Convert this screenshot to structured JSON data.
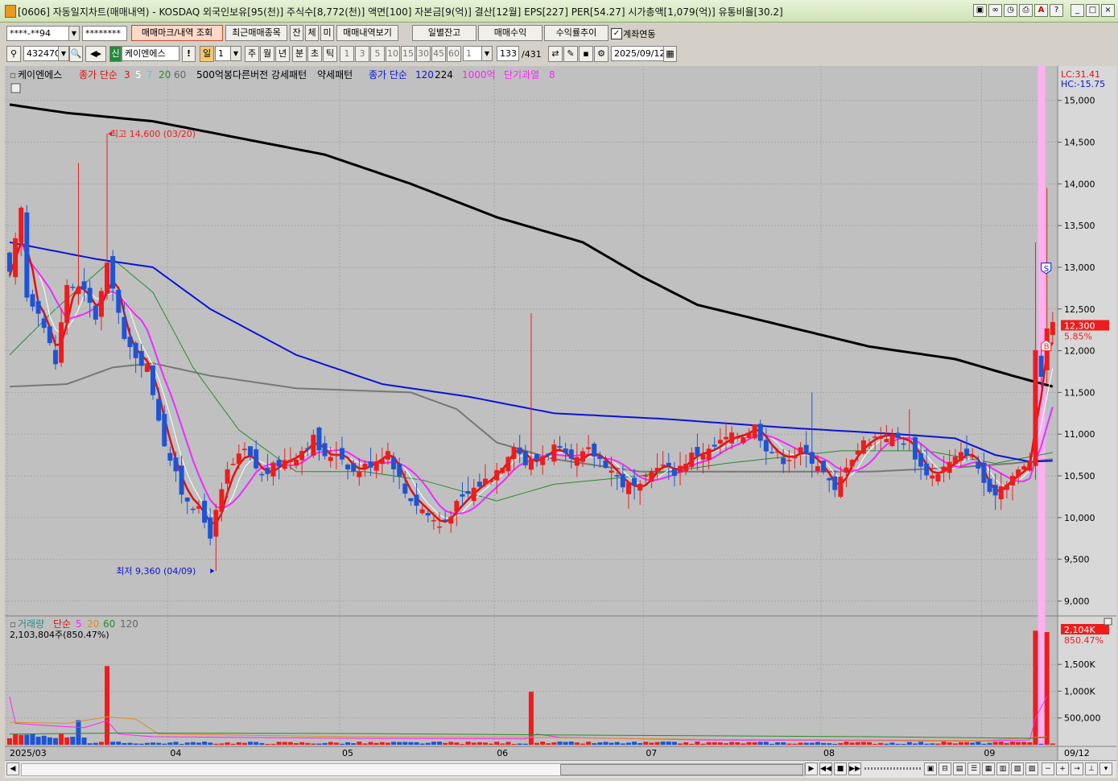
{
  "window": {
    "title": "[0606] 자동일지차트(매매내역) - KOSDAQ 외국인보유[95(천)] 주식수[8,772(천)] 액면[100] 자본금[9(억)] 결산[12월] EPS[227] PER[54.27] 시가총액[1,079(억)] 유통비율[30.2]"
  },
  "toolbar1": {
    "account": "****-**94",
    "password": "********",
    "btn_mark": "매매마크/내역 조회",
    "btn_recent": "최근매매종목",
    "btn_jan": "잔",
    "btn_che": "체",
    "btn_mi": "미",
    "btn_history": "매매내역보기",
    "btn_daily": "일별잔고",
    "btn_profit": "매매수익",
    "btn_trend": "수익률추이",
    "link_label": "계좌연동",
    "link_checked": true
  },
  "toolbar2": {
    "code": "432470",
    "stock_badge": "신",
    "stock_name": "케이엔에스",
    "period_day": "일",
    "period_num": "1",
    "periods": [
      "주",
      "월",
      "년",
      "분",
      "초",
      "틱"
    ],
    "intervals": [
      "1",
      "3",
      "5",
      "10",
      "15",
      "30",
      "45",
      "60"
    ],
    "interval_sel": "1",
    "count": "133",
    "total": "/431",
    "date": "2025/09/12"
  },
  "colors": {
    "up": "#ee1c1c",
    "down": "#1e54d4",
    "ma3": "#e01010",
    "ma5": "#ffffff",
    "ma7": "#7fe0e0",
    "ma20": "#2a8a2a",
    "ma60": "#777777",
    "ma120": "#0a14d8",
    "ma224": "#000000",
    "ma_mag": "#ff22ff",
    "bg": "#c0c0c0"
  },
  "legend": {
    "stock": "케이엔에스",
    "price_ma": "종가 단순",
    "p3": "3",
    "p5": "5",
    "p7": "7",
    "p20": "20",
    "p60": "60",
    "pattern1": "500억봉다른버전 강세패턴",
    "pattern2": "약세패턴",
    "ma120_label": "종가 단순",
    "p120": "120",
    "p224": "224",
    "thousand": "1000억",
    "short_over": "단기과열",
    "short_n": "8"
  },
  "right_info": {
    "lc": "LC:31.41",
    "hc": "HC:-15.75",
    "last_price": "12,300",
    "last_pct": "5.85%",
    "vol_last": "2,104K",
    "vol_pct": "850.47%"
  },
  "annotations": {
    "high": "최고 14,600 (03/20)",
    "low": "최저 9,360 (04/09)",
    "sell_mark": "S",
    "buy_mark": "B"
  },
  "volume_legend": {
    "title": "거래량",
    "ma": "단순",
    "p5": "5",
    "p20": "20",
    "p60": "60",
    "p120": "120",
    "info": "2,103,804주(850.47%)"
  },
  "chart_data": {
    "type": "candlestick",
    "price_axis": {
      "ticks": [
        9000,
        9500,
        10000,
        10500,
        11000,
        11500,
        12000,
        12500,
        13000,
        13500,
        14000,
        14500,
        15000
      ],
      "tick_labels": [
        "9,000",
        "9,500",
        "10,000",
        "10,500",
        "11,000",
        "11,500",
        "12,000",
        "12,500",
        "13,000",
        "13,500",
        "14,000",
        "14,500",
        "15,000"
      ],
      "ylim": [
        8850,
        15200
      ]
    },
    "volume_axis": {
      "ticks": [
        500000,
        1000000,
        1500000
      ],
      "tick_labels": [
        "500,000",
        "1,000K",
        "1,500K"
      ],
      "ylim": [
        0,
        2300000
      ]
    },
    "x_labels": [
      {
        "label": "2025/03",
        "index": 0
      },
      {
        "label": "04",
        "index": 28
      },
      {
        "label": "05",
        "index": 58
      },
      {
        "label": "06",
        "index": 85
      },
      {
        "label": "07",
        "index": 111
      },
      {
        "label": "08",
        "index": 142
      },
      {
        "label": "09",
        "index": 170
      },
      {
        "label": "09/12",
        "index": 181
      }
    ],
    "highlight_index": 180,
    "anchors": [
      [
        0,
        12900
      ],
      [
        2,
        13700
      ],
      [
        3,
        12650
      ],
      [
        5,
        12500
      ],
      [
        8,
        11850
      ],
      [
        10,
        12800
      ],
      [
        13,
        12700
      ],
      [
        15,
        12400
      ],
      [
        17,
        13000
      ],
      [
        18,
        12800
      ],
      [
        20,
        12100
      ],
      [
        22,
        11950
      ],
      [
        24,
        11800
      ],
      [
        27,
        10900
      ],
      [
        30,
        10300
      ],
      [
        33,
        10080
      ],
      [
        35,
        9800
      ],
      [
        38,
        10550
      ],
      [
        41,
        10800
      ],
      [
        44,
        10500
      ],
      [
        47,
        10650
      ],
      [
        50,
        10750
      ],
      [
        53,
        10950
      ],
      [
        55,
        10700
      ],
      [
        57,
        10800
      ],
      [
        60,
        10550
      ],
      [
        63,
        10650
      ],
      [
        66,
        10800
      ],
      [
        69,
        10300
      ],
      [
        72,
        10100
      ],
      [
        75,
        9900
      ],
      [
        78,
        10150
      ],
      [
        81,
        10350
      ],
      [
        84,
        10500
      ],
      [
        86,
        10650
      ],
      [
        88,
        10900
      ],
      [
        90,
        10650
      ],
      [
        92,
        10700
      ],
      [
        95,
        10850
      ],
      [
        98,
        10650
      ],
      [
        101,
        10800
      ],
      [
        104,
        10650
      ],
      [
        107,
        10400
      ],
      [
        110,
        10350
      ],
      [
        113,
        10650
      ],
      [
        116,
        10550
      ],
      [
        119,
        10750
      ],
      [
        122,
        10800
      ],
      [
        125,
        10950
      ],
      [
        128,
        11000
      ],
      [
        130,
        11100
      ],
      [
        132,
        10850
      ],
      [
        135,
        10700
      ],
      [
        138,
        10800
      ],
      [
        141,
        10650
      ],
      [
        144,
        10300
      ],
      [
        146,
        10650
      ],
      [
        149,
        10900
      ],
      [
        152,
        11000
      ],
      [
        155,
        10950
      ],
      [
        157,
        10900
      ],
      [
        159,
        10600
      ],
      [
        161,
        10500
      ],
      [
        164,
        10650
      ],
      [
        167,
        10800
      ],
      [
        169,
        10600
      ],
      [
        171,
        10250
      ],
      [
        174,
        10450
      ],
      [
        177,
        10600
      ],
      [
        178,
        10700
      ],
      [
        179,
        11950
      ],
      [
        180,
        11700
      ],
      [
        181,
        12300
      ]
    ],
    "highs": [
      {
        "index": 17,
        "high": 14600
      },
      {
        "index": 12,
        "high": 14250
      },
      {
        "index": 91,
        "high": 12450
      },
      {
        "index": 179,
        "high": 13300
      },
      {
        "index": 181,
        "high": 13950
      },
      {
        "index": 140,
        "high": 11500
      },
      {
        "index": 157,
        "high": 11300
      }
    ],
    "low_point": {
      "index": 36,
      "low": 9360
    },
    "mas": {
      "ma224": [
        [
          0,
          14950
        ],
        [
          10,
          14850
        ],
        [
          25,
          14750
        ],
        [
          40,
          14550
        ],
        [
          55,
          14350
        ],
        [
          70,
          14000
        ],
        [
          85,
          13600
        ],
        [
          100,
          13300
        ],
        [
          110,
          12900
        ],
        [
          120,
          12550
        ],
        [
          135,
          12300
        ],
        [
          150,
          12050
        ],
        [
          165,
          11900
        ],
        [
          175,
          11700
        ],
        [
          182,
          11570
        ]
      ],
      "ma120": [
        [
          0,
          13300
        ],
        [
          15,
          13100
        ],
        [
          25,
          13000
        ],
        [
          35,
          12500
        ],
        [
          50,
          11950
        ],
        [
          65,
          11600
        ],
        [
          80,
          11450
        ],
        [
          95,
          11250
        ],
        [
          115,
          11180
        ],
        [
          135,
          11080
        ],
        [
          155,
          11000
        ],
        [
          165,
          10950
        ],
        [
          172,
          10750
        ],
        [
          178,
          10670
        ],
        [
          182,
          10680
        ]
      ],
      "ma60": [
        [
          0,
          11570
        ],
        [
          10,
          11600
        ],
        [
          18,
          11800
        ],
        [
          25,
          11850
        ],
        [
          35,
          11700
        ],
        [
          50,
          11550
        ],
        [
          70,
          11500
        ],
        [
          78,
          11300
        ],
        [
          85,
          10900
        ],
        [
          95,
          10700
        ],
        [
          110,
          10550
        ],
        [
          125,
          10550
        ],
        [
          150,
          10550
        ],
        [
          165,
          10600
        ],
        [
          175,
          10650
        ],
        [
          182,
          10700
        ]
      ],
      "ma20": [
        [
          0,
          11950
        ],
        [
          8,
          12500
        ],
        [
          18,
          13100
        ],
        [
          25,
          12700
        ],
        [
          32,
          11800
        ],
        [
          40,
          11050
        ],
        [
          50,
          10550
        ],
        [
          62,
          10550
        ],
        [
          72,
          10450
        ],
        [
          85,
          10200
        ],
        [
          95,
          10400
        ],
        [
          110,
          10500
        ],
        [
          125,
          10650
        ],
        [
          145,
          10800
        ],
        [
          160,
          10800
        ],
        [
          172,
          10650
        ],
        [
          182,
          10780
        ]
      ]
    },
    "volume_spikes": [
      {
        "index": 17,
        "value": 1470000
      },
      {
        "index": 12,
        "value": 460000
      },
      {
        "index": 91,
        "value": 990000
      },
      {
        "index": 179,
        "value": 2130000
      },
      {
        "index": 181,
        "value": 2104000
      }
    ]
  }
}
